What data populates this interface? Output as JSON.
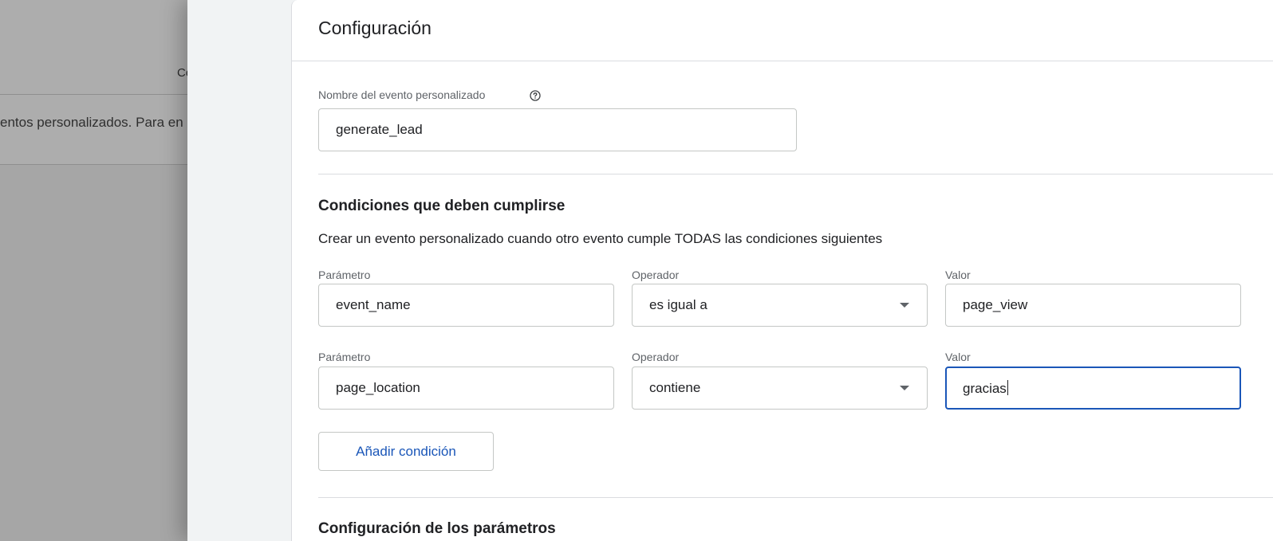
{
  "background": {
    "tab_text": "Co",
    "body_text": "entos personalizados. Para en"
  },
  "drawer": {
    "title": "Configuración",
    "event_name": {
      "label": "Nombre del evento personalizado",
      "help_icon": "help-circle-icon",
      "value": "generate_lead"
    },
    "conditions": {
      "heading": "Condiciones que deben cumplirse",
      "description": "Crear un evento personalizado cuando otro evento cumple TODAS las condiciones siguientes",
      "rows": [
        {
          "parameter_label": "Parámetro",
          "parameter_value": "event_name",
          "operator_label": "Operador",
          "operator_value": "es igual a",
          "value_label": "Valor",
          "value_value": "page_view"
        },
        {
          "parameter_label": "Parámetro",
          "parameter_value": "page_location",
          "operator_label": "Operador",
          "operator_value": "contiene",
          "value_label": "Valor",
          "value_value": "gracias"
        }
      ],
      "add_button_label": "Añadir condición"
    },
    "parameters_heading": "Configuración de los parámetros"
  },
  "colors": {
    "accent": "#1a56b8",
    "overlay": "#a6a6a6",
    "drawer_bg": "#f1f3f4"
  }
}
